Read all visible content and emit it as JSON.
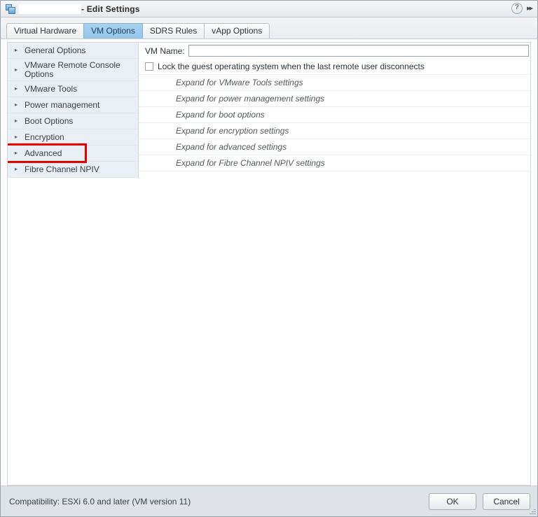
{
  "titlebar": {
    "vm_name_redacted": "",
    "title_suffix": "- Edit Settings",
    "help_glyph": "?",
    "expand_glyph": "▸▸",
    "icon_name": "virtual-machine-icon"
  },
  "tabs": [
    {
      "label": "Virtual Hardware",
      "active": false
    },
    {
      "label": "VM Options",
      "active": true
    },
    {
      "label": "SDRS Rules",
      "active": false
    },
    {
      "label": "vApp Options",
      "active": false
    }
  ],
  "sidebar": {
    "items": [
      {
        "label": "General Options",
        "highlighted": false
      },
      {
        "label": "VMware Remote Console Options",
        "highlighted": false
      },
      {
        "label": "VMware Tools",
        "highlighted": false
      },
      {
        "label": "Power management",
        "highlighted": false
      },
      {
        "label": "Boot Options",
        "highlighted": false
      },
      {
        "label": "Encryption",
        "highlighted": false
      },
      {
        "label": "Advanced",
        "highlighted": true
      },
      {
        "label": "Fibre Channel NPIV",
        "highlighted": false
      }
    ],
    "expand_triangle": "▸"
  },
  "content": {
    "vm_name_label": "VM Name:",
    "vm_name_value": "",
    "vm_name_placeholder": "",
    "lock_checkbox_label": "Lock the guest operating system when the last remote user disconnects",
    "lock_checkbox_checked": false,
    "rows": [
      "Expand for VMware Tools settings",
      "Expand for power management settings",
      "Expand for boot options",
      "Expand for encryption settings",
      "Expand for advanced settings",
      "Expand for Fibre Channel NPIV settings"
    ]
  },
  "footer": {
    "compatibility": "Compatibility: ESXi 6.0 and later (VM version 11)",
    "ok_label": "OK",
    "cancel_label": "Cancel"
  },
  "colors": {
    "accent_tab": "#9dcbee",
    "highlight": "#e60000",
    "sidebar_bg": "#e9eff4",
    "footer_bg": "#dfe3e8"
  }
}
